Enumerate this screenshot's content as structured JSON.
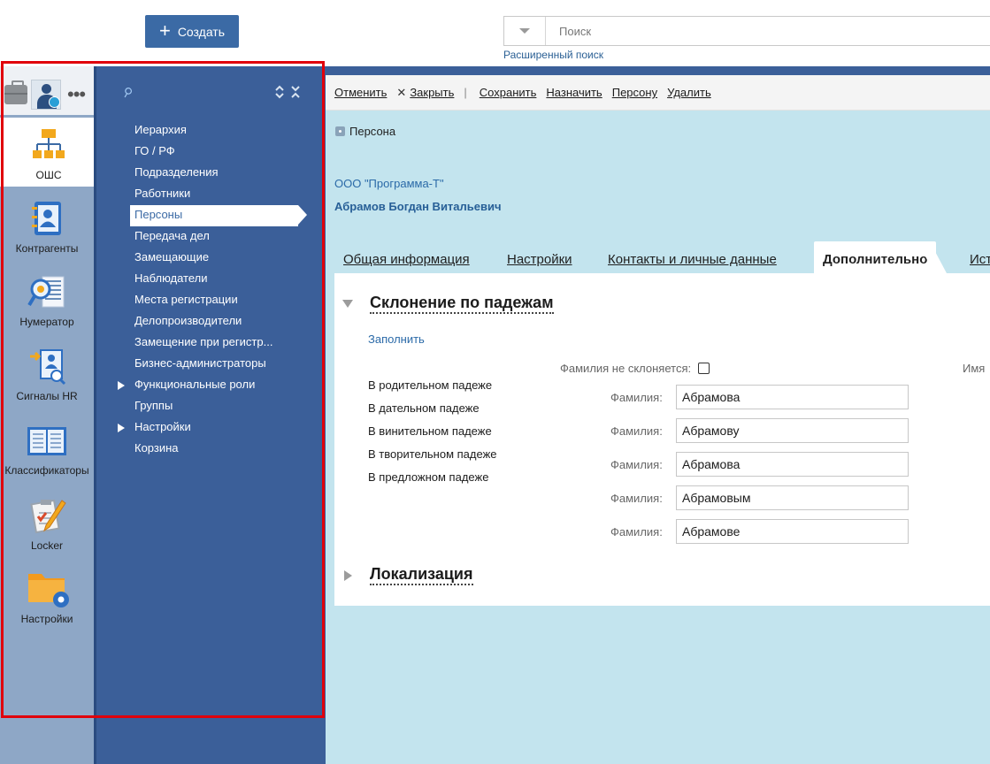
{
  "topbar": {
    "create_label": "Создать",
    "search_placeholder": "Поиск",
    "advanced_search": "Расширенный поиск"
  },
  "apps": [
    {
      "label": "ОШС",
      "icon": "org-structure-icon",
      "active": true
    },
    {
      "label": "Контрагенты",
      "icon": "address-book-icon"
    },
    {
      "label": "Нумератор",
      "icon": "numerator-icon"
    },
    {
      "label": "Сигналы HR",
      "icon": "hr-signals-icon"
    },
    {
      "label": "Классификаторы",
      "icon": "classifiers-icon"
    },
    {
      "label": "Locker",
      "icon": "locker-icon"
    },
    {
      "label": "Настройки",
      "icon": "settings-folder-icon"
    }
  ],
  "nav": {
    "items": [
      {
        "label": "Иерархия"
      },
      {
        "label": "ГО / РФ"
      },
      {
        "label": "Подразделения"
      },
      {
        "label": "Работники"
      },
      {
        "label": "Персоны",
        "selected": true
      },
      {
        "label": "Передача дел"
      },
      {
        "label": "Замещающие"
      },
      {
        "label": "Наблюдатели"
      },
      {
        "label": "Места регистрации"
      },
      {
        "label": "Делопроизводители"
      },
      {
        "label": "Замещение при регистр..."
      },
      {
        "label": "Бизнес-администраторы"
      },
      {
        "label": "Функциональные роли",
        "expandable": true
      },
      {
        "label": "Группы"
      },
      {
        "label": "Настройки",
        "expandable": true
      },
      {
        "label": "Корзина"
      }
    ]
  },
  "toolbar": {
    "cancel": "Отменить",
    "close": "Закрыть",
    "separator": "|",
    "save": "Сохранить",
    "assign": "Назначить",
    "person": "Персону",
    "delete": "Удалить"
  },
  "record": {
    "type_label": "Персона",
    "organization": "ООО \"Программа-Т\"",
    "full_name": "Абрамов Богдан Витальевич"
  },
  "tabs": [
    {
      "label": "Общая информация"
    },
    {
      "label": "Настройки"
    },
    {
      "label": "Контакты и личные данные"
    },
    {
      "label": "Дополнительно",
      "active": true
    },
    {
      "label": "Ист"
    }
  ],
  "declension": {
    "section_title": "Склонение по падежам",
    "fill_link": "Заполнить",
    "no_decline_label": "Фамилия не склоняется:",
    "no_decline_checked": false,
    "name_column_label": "Имя",
    "cases": [
      "В родительном падеже",
      "В дательном падеже",
      "В винительном падеже",
      "В творительном падеже",
      "В предложном падеже"
    ],
    "surname_label": "Фамилия:",
    "surnames": [
      "Абрамова",
      "Абрамову",
      "Абрамова",
      "Абрамовым",
      "Абрамове"
    ]
  },
  "localization": {
    "section_title": "Локализация"
  },
  "colors": {
    "accent": "#3b6aa5",
    "nav_bg": "#3b5f99",
    "main_bg": "#c3e4ee",
    "highlight_frame": "#e0000b"
  }
}
